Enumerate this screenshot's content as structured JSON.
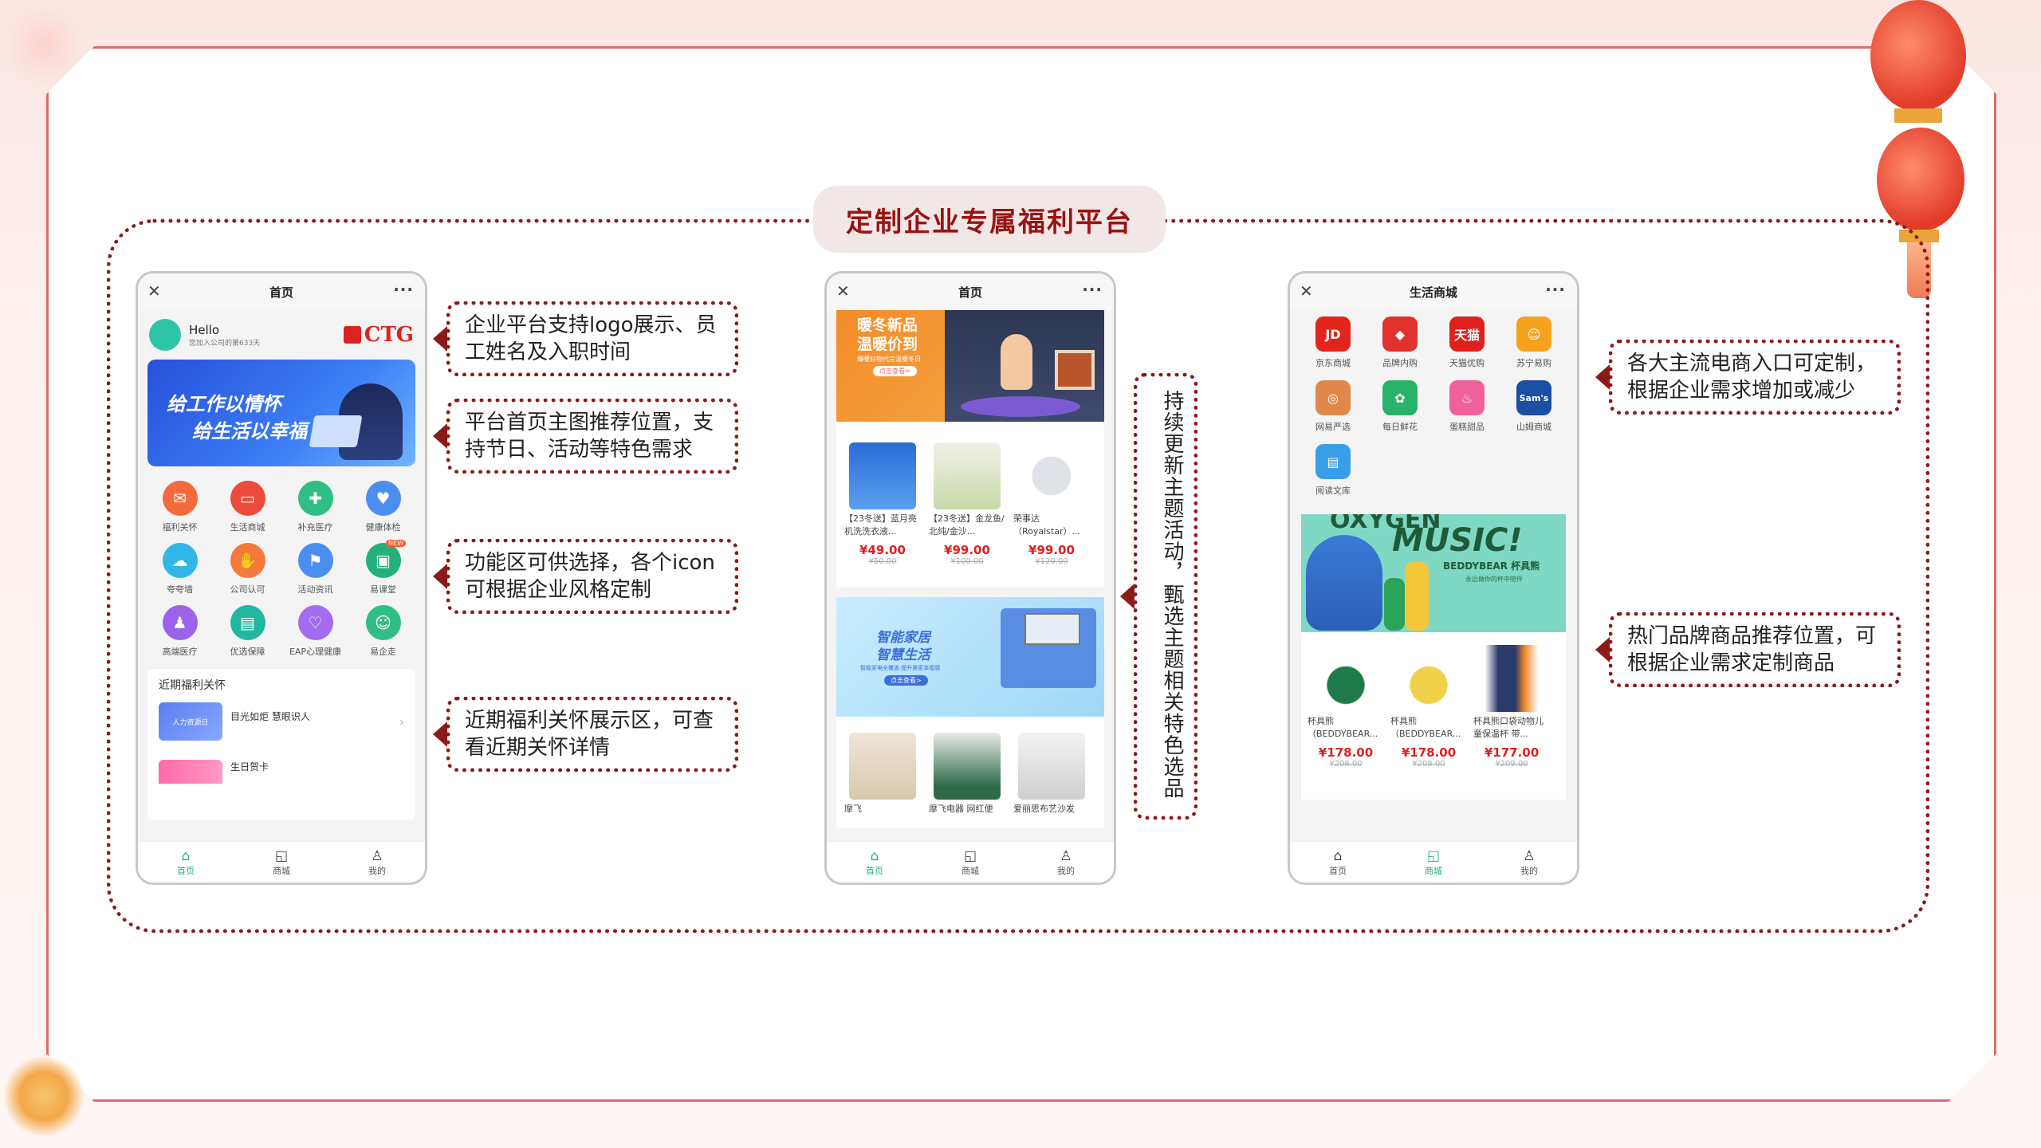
{
  "title": "定制企业专属福利平台",
  "phone1": {
    "header": "首页",
    "close_icon": "close-icon",
    "more_icon": "more-icon",
    "greeting": "Hello",
    "joined_text": "您加入公司的第633天",
    "logo_text": "CTG",
    "banner_line1": "给工作以情怀",
    "banner_line2": "给生活以幸福",
    "features": [
      "福利关怀",
      "生活商城",
      "补充医疗",
      "健康体检",
      "夸夸墙",
      "公司认可",
      "活动资讯",
      "易课堂",
      "高端医疗",
      "优选保障",
      "EAP心理健康",
      "易企走"
    ],
    "new_badge": "NEW",
    "recent_title": "近期福利关怀",
    "recent_items": [
      {
        "thumb": "人力资源日",
        "label": "目光如炬 慧眼识人"
      },
      {
        "thumb": "",
        "label": "生日贺卡"
      }
    ],
    "tabs": [
      "首页",
      "商城",
      "我的"
    ]
  },
  "phone2": {
    "header": "首页",
    "banner1_line1": "暖冬新品",
    "banner1_line2": "温暖价到",
    "banner1_small": "爆暖好物代言温暖冬日",
    "banner1_button": "点击查看>",
    "products1": [
      {
        "name": "【23冬送】蓝月亮机洗洗衣液...",
        "price": "¥49.00",
        "old": "¥50.00"
      },
      {
        "name": "【23冬送】金龙鱼/北纯/金沙...",
        "price": "¥99.00",
        "old": "¥100.00"
      },
      {
        "name": "荣事达（Royalstar）...",
        "price": "¥99.00",
        "old": "¥120.00"
      }
    ],
    "banner2_line1": "智能家居",
    "banner2_line2": "智慧生活",
    "banner2_small": "智能家电全覆盖 提升居家幸福感",
    "banner2_button": "点击查看>",
    "products2": [
      "摩飞",
      "摩飞电器 网红便",
      "爱丽思布艺沙发"
    ],
    "tabs": [
      "首页",
      "商城",
      "我的"
    ]
  },
  "phone3": {
    "header": "生活商城",
    "shops": [
      {
        "label": "京东商城",
        "icon": "JD",
        "color": "#e1251b"
      },
      {
        "label": "品牌内购",
        "icon": "◆",
        "color": "#e0312c"
      },
      {
        "label": "天猫优购",
        "icon": "天猫",
        "color": "#e0201a"
      },
      {
        "label": "苏宁易购",
        "icon": "☺",
        "color": "#f7a21c"
      },
      {
        "label": "网易严选",
        "icon": "◎",
        "color": "#e0884a"
      },
      {
        "label": "每日鲜花",
        "icon": "✿",
        "color": "#28b36a"
      },
      {
        "label": "蛋糕甜品",
        "icon": "♨",
        "color": "#f0609a"
      },
      {
        "label": "山姆商城",
        "icon": "Sam's",
        "color": "#1b4fa3"
      },
      {
        "label": "阅读文库",
        "icon": "▤",
        "color": "#3a9de8"
      }
    ],
    "banner_text": "MUSIC!",
    "banner_top": "OXYGEN",
    "banner_brand": "BEDDYBEAR 杯具熊",
    "banner_sub": "永远做你的杯中陪伴",
    "products": [
      {
        "name": "杯具熊（BEDDYBEAR...",
        "price": "¥178.00",
        "old": "¥208.00"
      },
      {
        "name": "杯具熊（BEDDYBEAR...",
        "price": "¥178.00",
        "old": "¥208.00"
      },
      {
        "name": "杯具熊口袋动物儿童保温杯 带...",
        "price": "¥177.00",
        "old": "¥209.00"
      }
    ],
    "tabs": [
      "首页",
      "商城",
      "我的"
    ]
  },
  "callouts": {
    "c1": "企业平台支持logo展示、员工姓名及入职时间",
    "c2": "平台首页主图推荐位置，支持节日、活动等特色需求",
    "c3": "功能区可供选择，各个icon可根据企业风格定制",
    "c4": "近期福利关怀展示区，可查看近期关怀详情",
    "c5": "持续更新主题活动，甄选主题相关特色选品",
    "c6": "各大主流电商入口可定制，根据企业需求增加或减少",
    "c7": "热门品牌商品推荐位置，可根据企业需求定制商品"
  },
  "colors": {
    "accent": "#9b1212",
    "green": "#22b07d",
    "price": "#e02020"
  }
}
